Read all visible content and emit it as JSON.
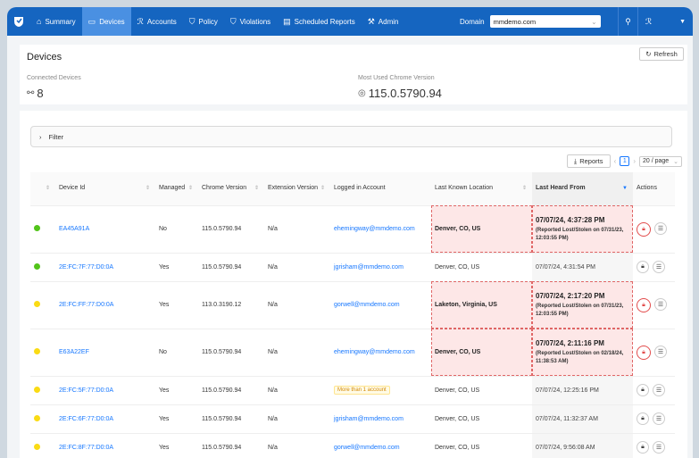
{
  "nav": {
    "items": [
      {
        "label": "Summary",
        "icon": "home-icon",
        "glyph": "⌂"
      },
      {
        "label": "Devices",
        "icon": "monitor-icon",
        "glyph": "▭"
      },
      {
        "label": "Accounts",
        "icon": "users-icon",
        "glyph": "ℛ"
      },
      {
        "label": "Policy",
        "icon": "shield-icon",
        "glyph": "⛉"
      },
      {
        "label": "Violations",
        "icon": "alert-shield-icon",
        "glyph": "⛉"
      },
      {
        "label": "Scheduled Reports",
        "icon": "report-icon",
        "glyph": "▤"
      },
      {
        "label": "Admin",
        "icon": "wrench-icon",
        "glyph": "⚒"
      }
    ],
    "domain_label": "Domain",
    "domain_value": "mmdemo.com"
  },
  "header": {
    "title": "Devices",
    "refresh_label": "Refresh",
    "connected_label": "Connected Devices",
    "connected_value": "8",
    "chrome_label": "Most Used Chrome Version",
    "chrome_value": "115.0.5790.94"
  },
  "filter_label": "Filter",
  "toolbar": {
    "reports_label": "Reports",
    "page": "1",
    "page_size": "20 / page"
  },
  "table": {
    "columns": [
      "Device Id",
      "Managed",
      "Chrome Version",
      "Extension Version",
      "Logged in Account",
      "Last Known Location",
      "Last Heard From",
      "Actions"
    ],
    "rows": [
      {
        "status": "#52c41a",
        "device": "EA45A91A",
        "managed": "No",
        "chrome": "115.0.5790.94",
        "ext": "N/a",
        "account": "ehemingway@mmdemo.com",
        "location": "Denver, CO, US",
        "heard": "07/07/24, 4:37:28 PM",
        "lost": "(Reported Lost/Stolen on 07/31/23, 12:03:55 PM)",
        "flag": true
      },
      {
        "status": "#52c41a",
        "device": "2E:FC:7F:77:D0:0A",
        "managed": "Yes",
        "chrome": "115.0.5790.94",
        "ext": "N/a",
        "account": "jgrisham@mmdemo.com",
        "location": "Denver, CO, US",
        "heard": "07/07/24, 4:31:54 PM",
        "lost": "",
        "flag": false
      },
      {
        "status": "#fadb14",
        "device": "2E:FC:FF:77:D0:0A",
        "managed": "Yes",
        "chrome": "113.0.3190.12",
        "ext": "N/a",
        "account": "gorwell@mmdemo.com",
        "location": "Laketon, Virginia, US",
        "heard": "07/07/24, 2:17:20 PM",
        "lost": "(Reported Lost/Stolen on 07/31/23, 12:03:55 PM)",
        "flag": true
      },
      {
        "status": "#fadb14",
        "device": "E63A22EF",
        "managed": "No",
        "chrome": "115.0.5790.94",
        "ext": "N/a",
        "account": "ehemingway@mmdemo.com",
        "location": "Denver, CO, US",
        "heard": "07/07/24, 2:11:16 PM",
        "lost": "(Reported Lost/Stolen on 02/18/24, 11:38:53 AM)",
        "flag": true
      },
      {
        "status": "#fadb14",
        "device": "2E:FC:5F:77:D0:0A",
        "managed": "Yes",
        "chrome": "115.0.5790.94",
        "ext": "N/a",
        "account": "More than 1 account",
        "location": "Denver, CO, US",
        "heard": "07/07/24, 12:25:16 PM",
        "lost": "",
        "flag": false,
        "tag": true
      },
      {
        "status": "#fadb14",
        "device": "2E:FC:6F:77:D0:0A",
        "managed": "Yes",
        "chrome": "115.0.5790.94",
        "ext": "N/a",
        "account": "jgrisham@mmdemo.com",
        "location": "Denver, CO, US",
        "heard": "07/07/24, 11:32:37 AM",
        "lost": "",
        "flag": false
      },
      {
        "status": "#fadb14",
        "device": "2E:FC:8F:77:D0:0A",
        "managed": "Yes",
        "chrome": "115.0.5790.94",
        "ext": "N/a",
        "account": "gorwell@mmdemo.com",
        "location": "Denver, CO, US",
        "heard": "07/07/24, 9:56:08 AM",
        "lost": "",
        "flag": false
      }
    ]
  }
}
